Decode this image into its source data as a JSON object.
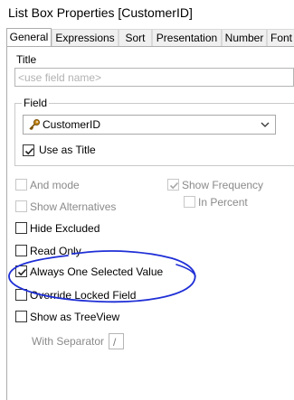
{
  "window": {
    "title": "List Box Properties [CustomerID]"
  },
  "tabs": [
    {
      "label": "General",
      "active": true
    },
    {
      "label": "Expressions"
    },
    {
      "label": "Sort"
    },
    {
      "label": "Presentation"
    },
    {
      "label": "Number"
    },
    {
      "label": "Font"
    }
  ],
  "title_section": {
    "label": "Title",
    "placeholder": "<use field name>"
  },
  "field_section": {
    "label": "Field",
    "selected": "CustomerID",
    "icon": "key-icon",
    "use_as_title": {
      "label": "Use as Title",
      "checked": true
    }
  },
  "options": {
    "and_mode": {
      "label": "And mode",
      "checked": false,
      "enabled": false
    },
    "show_alternatives": {
      "label": "Show Alternatives",
      "checked": false,
      "enabled": false
    },
    "show_frequency": {
      "label": "Show Frequency",
      "checked": true,
      "enabled": false
    },
    "in_percent": {
      "label": "In Percent",
      "checked": false,
      "enabled": false
    },
    "hide_excluded": {
      "label": "Hide Excluded",
      "checked": false,
      "enabled": true
    },
    "read_only": {
      "label": "Read Only",
      "checked": false,
      "enabled": true
    },
    "always_one_selected": {
      "label": "Always One Selected Value",
      "checked": true,
      "enabled": true
    },
    "override_locked": {
      "label": "Override Locked Field",
      "checked": false,
      "enabled": true
    },
    "show_as_treeview": {
      "label": "Show as TreeView",
      "checked": false,
      "enabled": true
    },
    "with_separator": {
      "label": "With Separator",
      "value": "/",
      "enabled": false
    }
  },
  "colors": {
    "annotation_ink": "#1f2fd6",
    "disabled_text": "#8a8a8a"
  }
}
